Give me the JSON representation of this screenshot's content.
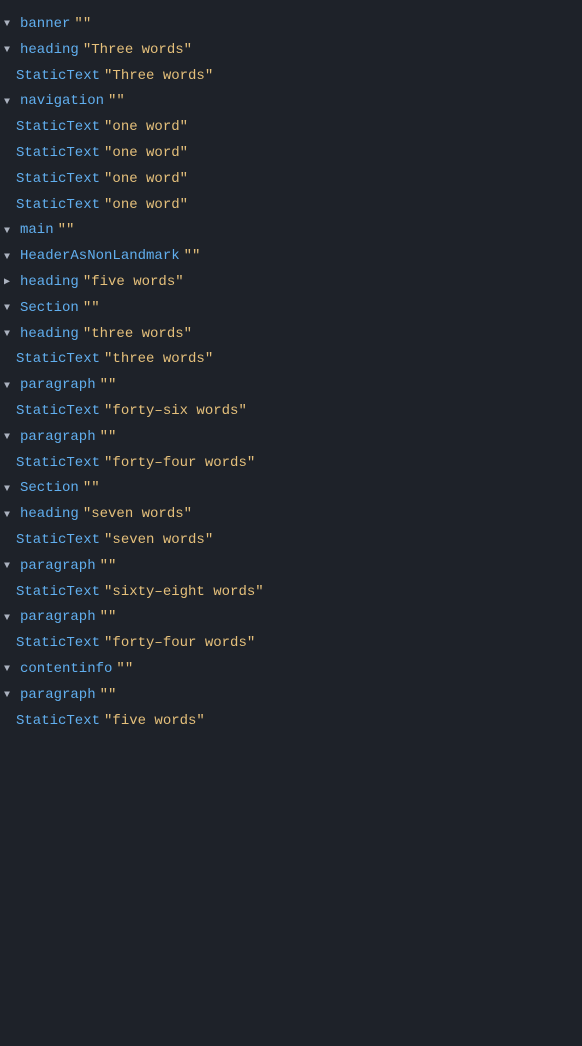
{
  "tree": {
    "nodes": [
      {
        "id": "banner",
        "indent": 1,
        "toggle": "open",
        "name": "banner",
        "value": "\"\"",
        "children": [
          {
            "id": "banner-heading",
            "indent": 2,
            "toggle": "open",
            "name": "heading",
            "value": "\"Three words\"",
            "children": [
              {
                "id": "banner-heading-static",
                "indent": 3,
                "toggle": "none",
                "name": "StaticText",
                "value": "\"Three words\""
              }
            ]
          },
          {
            "id": "banner-nav",
            "indent": 2,
            "toggle": "open",
            "name": "navigation",
            "value": "\"\"",
            "children": [
              {
                "id": "banner-nav-s1",
                "indent": 3,
                "toggle": "none",
                "name": "StaticText",
                "value": "\"one word\""
              },
              {
                "id": "banner-nav-s2",
                "indent": 3,
                "toggle": "none",
                "name": "StaticText",
                "value": "\"one word\""
              },
              {
                "id": "banner-nav-s3",
                "indent": 3,
                "toggle": "none",
                "name": "StaticText",
                "value": "\"one word\""
              },
              {
                "id": "banner-nav-s4",
                "indent": 3,
                "toggle": "none",
                "name": "StaticText",
                "value": "\"one word\""
              }
            ]
          }
        ]
      },
      {
        "id": "main",
        "indent": 1,
        "toggle": "open",
        "name": "main",
        "value": "\"\"",
        "children": [
          {
            "id": "main-header",
            "indent": 2,
            "toggle": "open",
            "name": "HeaderAsNonLandmark",
            "value": "\"\"",
            "children": [
              {
                "id": "main-header-heading",
                "indent": 3,
                "toggle": "closed",
                "name": "heading",
                "value": "\"five words\""
              }
            ]
          },
          {
            "id": "main-section1",
            "indent": 2,
            "toggle": "open",
            "name": "Section",
            "value": "\"\"",
            "children": [
              {
                "id": "section1-heading",
                "indent": 3,
                "toggle": "open",
                "name": "heading",
                "value": "\"three words\"",
                "children": [
                  {
                    "id": "section1-heading-static",
                    "indent": 4,
                    "toggle": "none",
                    "name": "StaticText",
                    "value": "\"three words\""
                  }
                ]
              },
              {
                "id": "section1-para1",
                "indent": 3,
                "toggle": "open",
                "name": "paragraph",
                "value": "\"\"",
                "children": [
                  {
                    "id": "section1-para1-static",
                    "indent": 4,
                    "toggle": "none",
                    "name": "StaticText",
                    "value": "\"forty-six words\""
                  }
                ]
              },
              {
                "id": "section1-para2",
                "indent": 3,
                "toggle": "open",
                "name": "paragraph",
                "value": "\"\"",
                "children": [
                  {
                    "id": "section1-para2-static",
                    "indent": 4,
                    "toggle": "none",
                    "name": "StaticText",
                    "value": "\"forty-four words\""
                  }
                ]
              }
            ]
          },
          {
            "id": "main-section2",
            "indent": 2,
            "toggle": "open",
            "name": "Section",
            "value": "\"\"",
            "children": [
              {
                "id": "section2-heading",
                "indent": 3,
                "toggle": "open",
                "name": "heading",
                "value": "\"seven words\"",
                "children": [
                  {
                    "id": "section2-heading-static",
                    "indent": 4,
                    "toggle": "none",
                    "name": "StaticText",
                    "value": "\"seven words\""
                  }
                ]
              },
              {
                "id": "section2-para1",
                "indent": 3,
                "toggle": "open",
                "name": "paragraph",
                "value": "\"\"",
                "children": [
                  {
                    "id": "section2-para1-static",
                    "indent": 4,
                    "toggle": "none",
                    "name": "StaticText",
                    "value": "\"sixty-eight words\""
                  }
                ]
              },
              {
                "id": "section2-para2",
                "indent": 3,
                "toggle": "open",
                "name": "paragraph",
                "value": "\"\"",
                "children": [
                  {
                    "id": "section2-para2-static",
                    "indent": 4,
                    "toggle": "none",
                    "name": "StaticText",
                    "value": "\"forty-four words\""
                  }
                ]
              }
            ]
          }
        ]
      },
      {
        "id": "contentinfo",
        "indent": 1,
        "toggle": "open",
        "name": "contentinfo",
        "value": "\"\"",
        "children": [
          {
            "id": "contentinfo-para",
            "indent": 2,
            "toggle": "open",
            "name": "paragraph",
            "value": "\"\"",
            "children": [
              {
                "id": "contentinfo-para-static",
                "indent": 3,
                "toggle": "none",
                "name": "StaticText",
                "value": "\"five words\""
              }
            ]
          }
        ]
      }
    ]
  },
  "colors": {
    "bg": "#1e2229",
    "node_name": "#61afef",
    "node_value": "#e5c07b",
    "text": "#abb2bf"
  }
}
